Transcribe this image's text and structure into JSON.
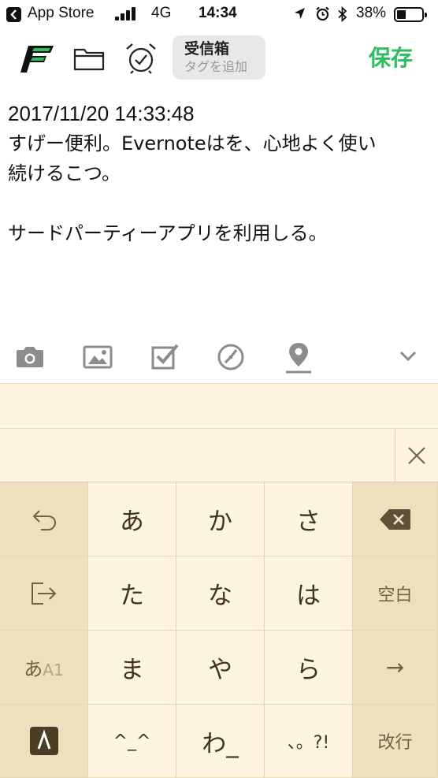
{
  "status_bar": {
    "back_label": "App Store",
    "network": "4G",
    "time": "14:34",
    "battery_percent": "38%",
    "battery_level": 0.38
  },
  "toolbar": {
    "notebook_name": "受信箱",
    "tag_placeholder": "タグを追加",
    "save_label": "保存",
    "brand_color": "#2dbe60"
  },
  "note": {
    "lines": [
      "2017/11/20 14:33:48",
      "すげー便利。Evernoteはを、心地よく使い",
      "続けるこつ。",
      "",
      "サードパーティーアプリを利用しる。"
    ]
  },
  "format_bar": {
    "icons": [
      "camera-icon",
      "image-icon",
      "checkbox-icon",
      "reminder-icon",
      "location-icon",
      "chevron-down-icon"
    ]
  },
  "keyboard": {
    "rows": [
      [
        "undo-icon",
        "あ",
        "か",
        "さ",
        "backspace-icon"
      ],
      [
        "cursor-icon",
        "た",
        "な",
        "は",
        "空白"
      ],
      [
        "あA1",
        "ま",
        "や",
        "ら",
        "→"
      ],
      [
        "keyboard-switch-icon",
        "^_^",
        "わ_",
        "、。?!",
        "改行"
      ]
    ],
    "mode_kana": "あ",
    "mode_alpha": "A1",
    "space_label": "空白",
    "enter_label": "改行",
    "arrow_label": "→",
    "colors": {
      "key_bg": "#fdf5e0",
      "fn_key_bg": "#eee0bc"
    }
  }
}
